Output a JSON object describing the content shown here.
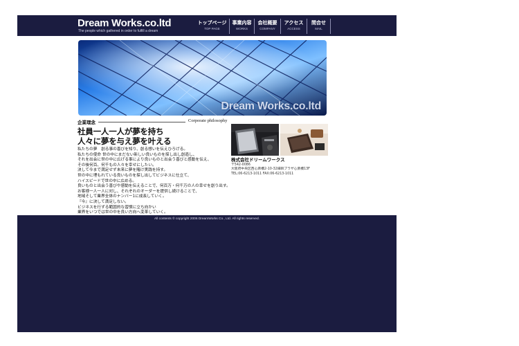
{
  "header": {
    "logo": "Dream Works.co.ltd",
    "tagline": "The people which gathered in order to fulfill a dream"
  },
  "nav": {
    "items": [
      {
        "jp": "トップページ",
        "en": "TOP PAGE"
      },
      {
        "jp": "事業内容",
        "en": "WORKS"
      },
      {
        "jp": "会社概要",
        "en": "COMPANY"
      },
      {
        "jp": "アクセス",
        "en": "ACCESS"
      },
      {
        "jp": "問合せ",
        "en": "MAIL"
      }
    ]
  },
  "hero": {
    "caption": "Dream Works.co.ltd"
  },
  "philosophy": {
    "heading_jp": "企業理念",
    "heading_en": "Corporate philosophy",
    "slogan_1": "社員一人一人が夢を持ち",
    "slogan_2": "人々に夢を与え夢を叶える",
    "lines": [
      "私たちの夢　創る事の喜びを知り、創る想いを伝えひろげる。",
      "私たちの使命 世の中にまだない新しい良いものを探し出し創造し、",
      "それを出会に世の中に広げる事により良いものと出会う喜びと感動を伝え、",
      "その後何百、何千もの人々を幸せにしたい。",
      "決して今まで満足せず未来に夢を賭け実践を持す。",
      "世の中に埋もれている良いものを探し出してビジネスに仕立て、",
      "ハイスピードで世の中に広める。",
      "良いものと出会う喜びや感動を伝えることで、何百万・何千万の人の幸せを創り出す。",
      "お客様一人一人に対し、それぞれのオーダーを提供し続けることで、",
      "地域そして業界全体のナンバー1に成長していく。",
      "『今』に決して満足しない。",
      "ビジネスを行ずる範囲的な習慣に立ち向かい",
      "業界をいつでは世の中を良い方向へ変革していく。"
    ]
  },
  "company": {
    "name": "株式会社ドリームワークス",
    "postal": "〒542-0086",
    "address": "大阪府中央区西心斎橋2-10-32細目プラザ心斎橋13F",
    "contact": "TEL:06-6213-1011 FAX:06-6213-1011"
  },
  "footer": {
    "copyright": "All contents © copyright 2006 DreamWorks Co., Ltd. All rights reserved."
  },
  "colors": {
    "header_bg": "#1b1c40",
    "footer_bg": "#1b1c40",
    "hero_accent": "#1f6fe0"
  }
}
